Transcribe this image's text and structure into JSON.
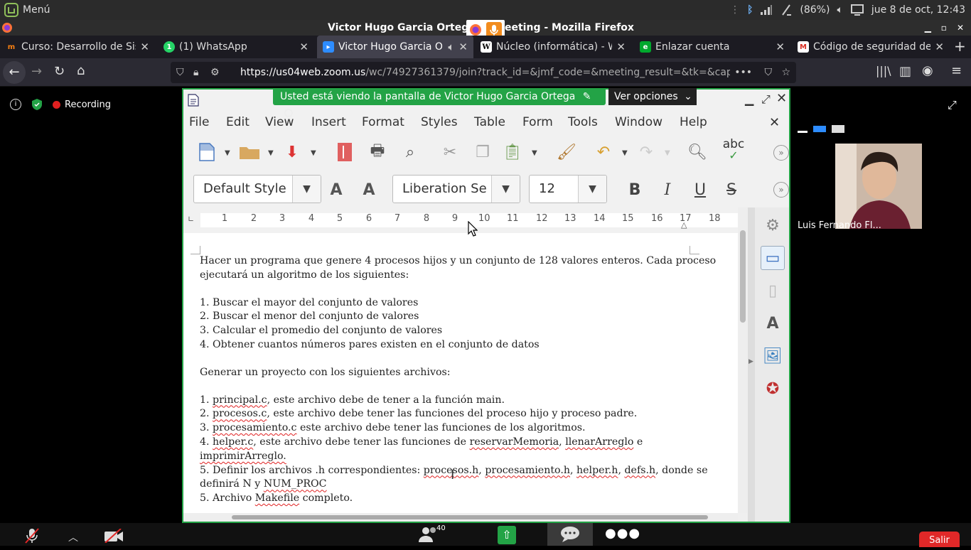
{
  "system_panel": {
    "menu_label": "Menú",
    "battery": "(86%)",
    "datetime": "jue  8 de oct, 12:43"
  },
  "window": {
    "title": "Victor Hugo Garcia Ortega's Zoom Meeting - Mozilla Firefox",
    "title_left": "Victor Hugo Garcia Ortega's",
    "title_right": "eeting - Mozilla Firefox"
  },
  "tabs": [
    {
      "label": "Curso: Desarrollo de Sist"
    },
    {
      "label": "(1) WhatsApp"
    },
    {
      "label": "Victor Hugo Garcia Or"
    },
    {
      "label": "Núcleo (informática) - W"
    },
    {
      "label": "Enlazar cuenta"
    },
    {
      "label": "Código de seguridad de"
    }
  ],
  "address_bar": {
    "url_host": "https://us04web.zoom.us",
    "url_path": "/wc/74927361379/join?track_id=&jmf_code=&meeting_result=&tk=&cap="
  },
  "zoom": {
    "recording_label": "Recording",
    "sharing_banner": "Usted está viendo la pantalla de Victor Hugo Garcia Ortega",
    "view_options": "Ver opciones",
    "participant_name": "Luis Fernando Fl...",
    "participants_count": "40",
    "leave_label": "Salir",
    "colors": {
      "share_green": "#23a346",
      "leave_red": "#e02828",
      "record_red": "#e02020"
    }
  },
  "writer": {
    "menu": [
      "File",
      "Edit",
      "View",
      "Insert",
      "Format",
      "Styles",
      "Table",
      "Form",
      "Tools",
      "Window",
      "Help"
    ],
    "para_style": "Default Style",
    "font_name": "Liberation Se",
    "font_size": "12",
    "bold_label": "B",
    "italic_label": "I",
    "underline_label": "U",
    "strike_label": "S",
    "spellcheck_label": "abc",
    "ruler_numbers": [
      "1",
      "2",
      "3",
      "4",
      "5",
      "6",
      "7",
      "8",
      "9",
      "10",
      "11",
      "12",
      "13",
      "14",
      "15",
      "16",
      "17",
      "18"
    ]
  },
  "doc": {
    "intro_1": "Hacer un programa que genere 4 procesos hijos y un conjunto de 128 valores enteros. Cada proceso",
    "intro_2": "ejecutará un algoritmo de los siguientes:",
    "alg_1": "1. Buscar el mayor del conjunto de valores",
    "alg_2": "2. Buscar el menor del conjunto de valores",
    "alg_3": "3. Calcular el promedio del conjunto de valores",
    "alg_4": "4. Obtener cuantos números pares existen en el conjunto de datos",
    "files_heading": "Generar un proyecto con los siguientes archivos:",
    "f1_pre": "1. ",
    "f1_sq": "principal.c",
    "f1_post": ", este archivo debe de tener a la función main.",
    "f2_pre": "2. ",
    "f2_sq": "procesos.c",
    "f2_post": ", este archivo debe tener las funciones del proceso hijo y proceso padre.",
    "f3_pre": "3. ",
    "f3_sq": "procesamiento.c",
    "f3_post": " este archivo debe tener las funciones de los algoritmos.",
    "f4_pre": "4. ",
    "f4_sq": "helper.c",
    "f4_mid": ", este archivo debe tener las funciones de ",
    "f4_sq2": "reservarMemoria",
    "f4_mid2": ", ",
    "f4_sq3": "llenarArreglo",
    "f4_post": " e",
    "f4_line2": "imprimirArreglo.",
    "f5_pre": "5. Definir los archivos .h correspondientes: ",
    "f5_sq1": "procesos.h",
    "f5_c1": ", ",
    "f5_sq2": "procesamiento.h",
    "f5_c2": ", ",
    "f5_sq3": "helper.h",
    "f5_c3": ", ",
    "f5_sq4": "defs.h",
    "f5_post": ", donde se",
    "f5_line2_pre": "definirá N y ",
    "f5_line2_sq": "NUM_PROC",
    "f6_pre": "5. Archivo ",
    "f6_sq": "Makefile",
    "f6_post": " completo."
  }
}
